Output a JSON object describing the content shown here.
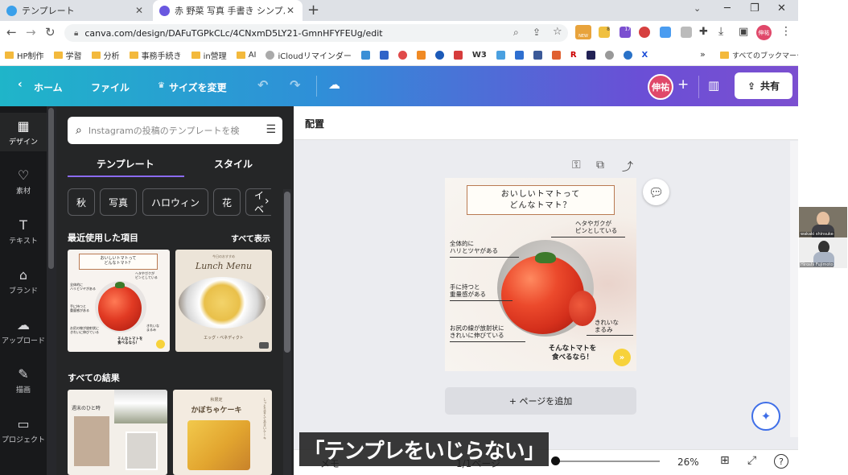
{
  "browser": {
    "tabs": [
      {
        "title": "テンプレート",
        "active": false
      },
      {
        "title": "赤 野菜 写真 手書き シンプル 解説",
        "active": true
      }
    ],
    "new_tab": "+",
    "url": "canva.com/design/DAFuTGPkCLc/4CNxmD5LY21-GmnHFYFEUg/edit",
    "window_controls": {
      "minimize": "─",
      "maximize": "❐",
      "close": "✕"
    },
    "ext_badges": {
      "new": "NEW",
      "eight": "8",
      "seventeen": "17"
    },
    "profile": "伸祐",
    "bookmarks": [
      "HP制作",
      "学習",
      "分析",
      "事務手続き",
      "in營理",
      "AI",
      "iCloudリマインダー",
      "W3",
      "R",
      "X"
    ],
    "bookmarks_more": "»",
    "all_bookmarks": "すべてのブックマーク"
  },
  "canva_header": {
    "back": "‹",
    "home": "ホーム",
    "file": "ファイル",
    "resize_icon": "♛",
    "resize": "サイズを変更",
    "avatar": "伸祐",
    "add": "+",
    "share": "共有"
  },
  "rail": [
    {
      "label": "デザイン",
      "icon": "layout-icon",
      "active": true
    },
    {
      "label": "素材",
      "icon": "elements-icon",
      "active": false
    },
    {
      "label": "テキスト",
      "icon": "text-icon",
      "active": false
    },
    {
      "label": "ブランド",
      "icon": "brand-icon",
      "active": false
    },
    {
      "label": "アップロード",
      "icon": "upload-icon",
      "active": false
    },
    {
      "label": "描画",
      "icon": "draw-icon",
      "active": false
    },
    {
      "label": "プロジェクト",
      "icon": "folder-icon",
      "active": false
    }
  ],
  "panel": {
    "search_placeholder": "Instagramの投稿のテンプレートを検",
    "tabs": [
      "テンプレート",
      "スタイル"
    ],
    "chips": [
      "秋",
      "写真",
      "ハロウィン",
      "花",
      "イベ"
    ],
    "recent_heading": "最近使用した項目",
    "show_all": "すべて表示",
    "all_results_heading": "すべての結果",
    "lunch_menu": "Lunch Menu",
    "lunch_top": "今日のおすすめ",
    "lunch_sub": "エッグ・ベネディクト",
    "pumpkin_small": "秋限定",
    "pumpkin_title": "かぼちゃケーキ",
    "pumpkin_side": "しっとり甘くてあまいケーキ",
    "weekend_text": "週末のひと時"
  },
  "toolbar": {
    "label": "配置"
  },
  "design": {
    "title_line1": "おいしいトマトって",
    "title_line2": "どんなトマト？",
    "labels": {
      "heta_line1": "ヘタやガクが",
      "heta_line2": "ピンとしている",
      "zentai_line1": "全体的に",
      "zentai_line2": "ハリとツヤがある",
      "te_line1": "手に持つと",
      "te_line2": "重量感がある",
      "shiri_line1": "お尻の線が放射状に",
      "shiri_line2": "きれいに伸びている",
      "kirei_line1": "きれいな",
      "kirei_line2": "まるみ"
    },
    "closing_line1": "そんなトマトを",
    "closing_line2": "食べるなら！",
    "badge": "»"
  },
  "add_page": "+ ページを追加",
  "status": {
    "notes": "メモ",
    "pages": "1/1ページ",
    "zoom": "26%",
    "help": "?"
  },
  "subtitle": "「テンプレをいじらない」",
  "call": {
    "participant1": "wakaki shinsuke",
    "participant2": "Hiroshi Fujimoto"
  },
  "colors": {
    "canva_gradient_start": "#1fb5c9",
    "canva_gradient_end": "#7b4fd0",
    "panel_bg": "#252627",
    "rail_bg": "#18191b",
    "tomato": "#e13a23",
    "badge_yellow": "#f7d23b",
    "avatar": "#e0486a"
  }
}
